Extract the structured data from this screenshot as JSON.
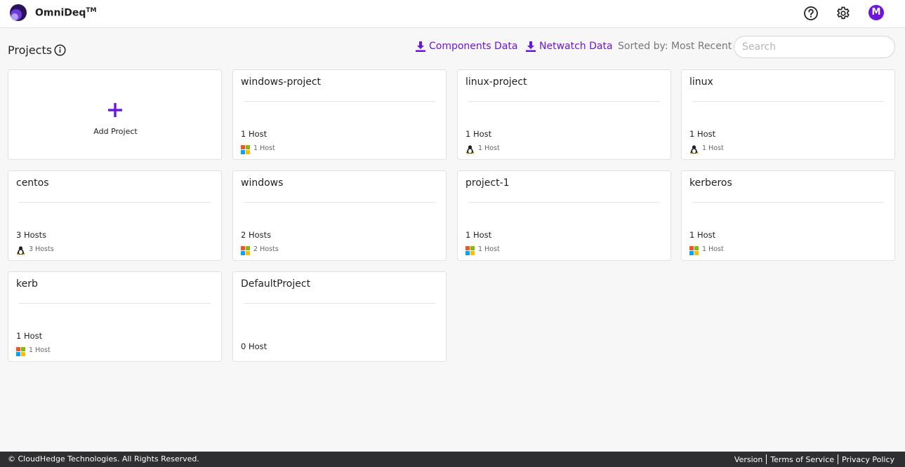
{
  "header": {
    "brand": "OmniDeq",
    "trademark": "TM",
    "avatar_letter": "M",
    "accent_color": "#6d14e0"
  },
  "toolbar": {
    "title": "Projects",
    "components_label": "Components Data",
    "netwatch_label": "Netwatch Data",
    "sorted_label": "Sorted by: Most Recent",
    "search_placeholder": "Search"
  },
  "add_project_label": "Add Project",
  "projects": [
    {
      "name": "windows-project",
      "hosts": "1 Host",
      "os": "windows-icon",
      "os_label": "1 Host"
    },
    {
      "name": "linux-project",
      "hosts": "1 Host",
      "os": "linux-icon",
      "os_label": "1 Host"
    },
    {
      "name": "linux",
      "hosts": "1 Host",
      "os": "linux-icon",
      "os_label": "1 Host"
    },
    {
      "name": "centos",
      "hosts": "3 Hosts",
      "os": "linux-icon",
      "os_label": "3 Hosts"
    },
    {
      "name": "windows",
      "hosts": "2 Hosts",
      "os": "windows-icon",
      "os_label": "2 Hosts"
    },
    {
      "name": "project-1",
      "hosts": "1 Host",
      "os": "windows-icon",
      "os_label": "1 Host"
    },
    {
      "name": "kerberos",
      "hosts": "1 Host",
      "os": "windows-icon",
      "os_label": "1 Host"
    },
    {
      "name": "kerb",
      "hosts": "1 Host",
      "os": "windows-icon",
      "os_label": "1 Host"
    },
    {
      "name": "DefaultProject",
      "hosts": "0 Host",
      "os": "",
      "os_label": ""
    }
  ],
  "footer": {
    "copyright": "© CloudHedge Technologies. All Rights Reserved.",
    "links": [
      "Version",
      "Terms of Service",
      "Privacy Policy"
    ]
  }
}
